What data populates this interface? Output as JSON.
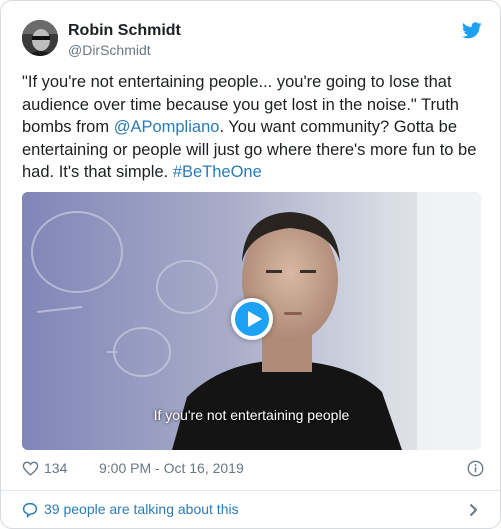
{
  "author": {
    "name": "Robin Schmidt",
    "handle": "@DirSchmidt"
  },
  "tweet": {
    "text_1": "\"If you're not entertaining people...  you're going to lose that audience over time because you get lost in the noise.\" Truth bombs from ",
    "mention": "@APompliano",
    "text_2": ". You want community? Gotta be entertaining or people will just go where there's more fun to be had. It's that simple. ",
    "hashtag": "#BeTheOne"
  },
  "video": {
    "caption": "If you're not entertaining people"
  },
  "meta": {
    "likes": "134",
    "timestamp": "9:00 PM - Oct 16, 2019"
  },
  "footer": {
    "talking": "39 people are talking about this"
  },
  "colors": {
    "link": "#2b7bb9",
    "brand": "#1da1f2",
    "secondary_text": "#697882"
  },
  "icons": {
    "brand": "twitter-bird-icon",
    "like": "heart-icon",
    "info": "info-icon",
    "reply": "speech-bubble-icon",
    "more": "chevron-right-icon",
    "play": "play-icon"
  }
}
